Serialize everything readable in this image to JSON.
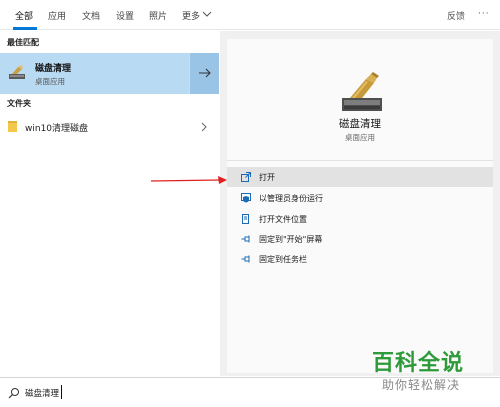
{
  "tabs": [
    {
      "label": "全部",
      "active": true
    },
    {
      "label": "应用"
    },
    {
      "label": "文档"
    },
    {
      "label": "设置"
    },
    {
      "label": "照片"
    },
    {
      "label": "更多"
    }
  ],
  "header": {
    "feedback_label": "反馈",
    "more_label": "···"
  },
  "left": {
    "best_match_title": "最佳匹配",
    "best_match": {
      "name": "磁盘清理",
      "subtitle": "桌面应用"
    },
    "folders_title": "文件夹",
    "folder_item": "win10清理磁盘"
  },
  "details": {
    "title": "磁盘清理",
    "subtitle": "桌面应用",
    "actions": [
      {
        "label": "打开",
        "icon": "open-icon",
        "highlighted": true
      },
      {
        "label": "以管理员身份运行",
        "icon": "admin-shield-icon"
      },
      {
        "label": "打开文件位置",
        "icon": "file-location-icon"
      },
      {
        "label": "固定到\"开始\"屏幕",
        "icon": "pin-icon"
      },
      {
        "label": "固定到任务栏",
        "icon": "pin-icon"
      }
    ]
  },
  "search": {
    "value": "磁盘清理"
  },
  "watermark": {
    "title": "百科全说",
    "subtitle": "助你轻松解决"
  },
  "colors": {
    "accent": "#0078d7",
    "selection": "#b9daf3",
    "annotation": "#e02020",
    "watermark": "#2e9a3a"
  }
}
